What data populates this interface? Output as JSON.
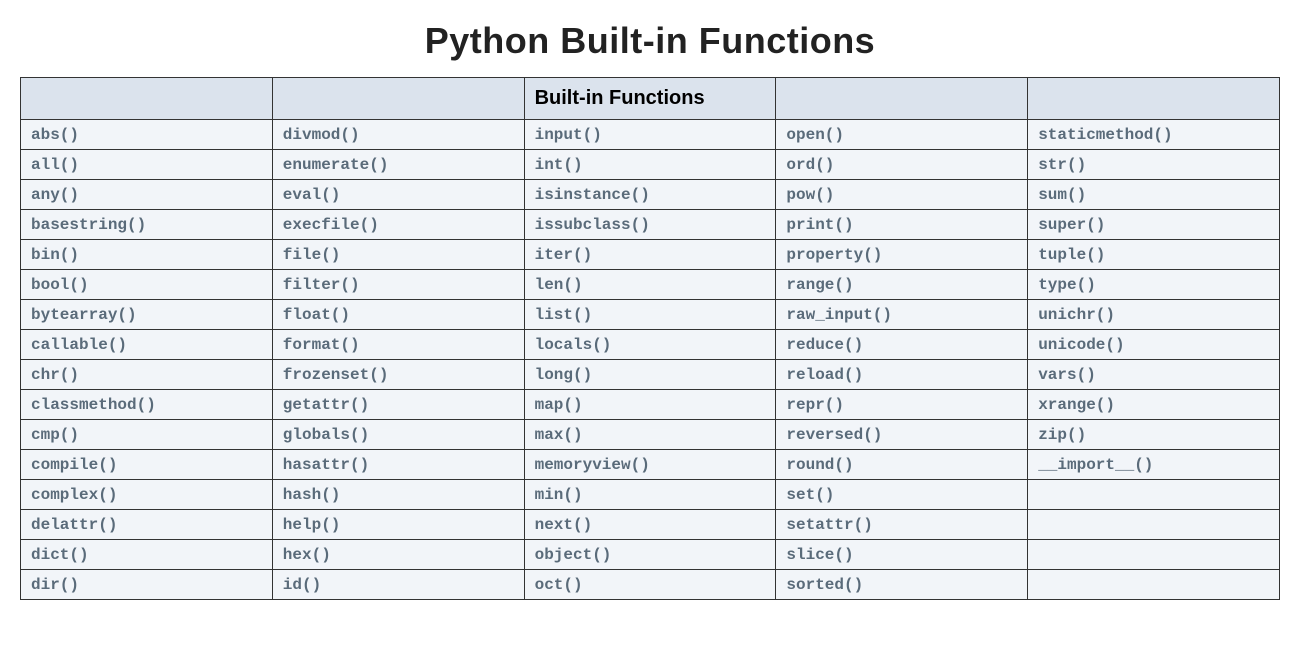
{
  "title": "Python Built-in Functions",
  "header": {
    "cols": [
      "",
      "",
      "Built-in Functions",
      "",
      ""
    ]
  },
  "table": {
    "rows": [
      [
        "abs()",
        "divmod()",
        "input()",
        "open()",
        "staticmethod()"
      ],
      [
        "all()",
        "enumerate()",
        "int()",
        "ord()",
        "str()"
      ],
      [
        "any()",
        "eval()",
        "isinstance()",
        "pow()",
        "sum()"
      ],
      [
        "basestring()",
        "execfile()",
        "issubclass()",
        "print()",
        "super()"
      ],
      [
        "bin()",
        "file()",
        "iter()",
        "property()",
        "tuple()"
      ],
      [
        "bool()",
        "filter()",
        "len()",
        "range()",
        "type()"
      ],
      [
        "bytearray()",
        "float()",
        "list()",
        "raw_input()",
        "unichr()"
      ],
      [
        "callable()",
        "format()",
        "locals()",
        "reduce()",
        "unicode()"
      ],
      [
        "chr()",
        "frozenset()",
        "long()",
        "reload()",
        "vars()"
      ],
      [
        "classmethod()",
        "getattr()",
        "map()",
        "repr()",
        "xrange()"
      ],
      [
        "cmp()",
        "globals()",
        "max()",
        "reversed()",
        "zip()"
      ],
      [
        "compile()",
        "hasattr()",
        "memoryview()",
        "round()",
        "__import__()"
      ],
      [
        "complex()",
        "hash()",
        "min()",
        "set()",
        ""
      ],
      [
        "delattr()",
        "help()",
        "next()",
        "setattr()",
        ""
      ],
      [
        "dict()",
        "hex()",
        "object()",
        "slice()",
        ""
      ],
      [
        "dir()",
        "id()",
        "oct()",
        "sorted()",
        ""
      ]
    ]
  }
}
